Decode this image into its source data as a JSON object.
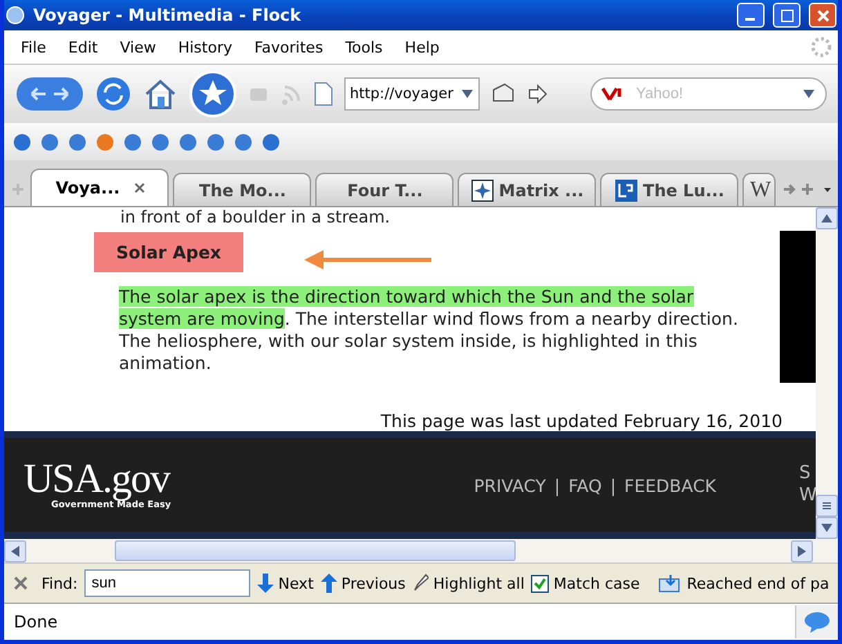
{
  "window": {
    "title": "Voyager - Multimedia - Flock"
  },
  "menu": [
    "File",
    "Edit",
    "View",
    "History",
    "Favorites",
    "Tools",
    "Help"
  ],
  "address": {
    "value": "http://voyager"
  },
  "search": {
    "placeholder": "Yahoo!"
  },
  "tabs": [
    {
      "label": "Voya...",
      "selected": true,
      "kind": "plain"
    },
    {
      "label": "The Mo...",
      "selected": false,
      "kind": "plain"
    },
    {
      "label": "Four T...",
      "selected": false,
      "kind": "plain"
    },
    {
      "label": "Matrix ...",
      "selected": false,
      "kind": "compass"
    },
    {
      "label": "The Lu...",
      "selected": false,
      "kind": "logo"
    },
    {
      "label": "W",
      "selected": false,
      "kind": "serif"
    }
  ],
  "page": {
    "cut_line": "in front of a boulder in a stream.",
    "heading": "Solar Apex",
    "highlighted": "The solar apex is the direction toward which the Sun and the solar system are moving",
    "rest": ". The interstellar wind flows from a nearby direction. The heliosphere, with our solar system inside, is highlighted in this animation.",
    "updated": "This page was last updated February 16, 2010"
  },
  "footer": {
    "logo": "USA.gov",
    "logo_tagline": "Government Made Easy",
    "links": [
      "PRIVACY",
      "FAQ",
      "FEEDBACK"
    ],
    "separator": "|",
    "cut_text": [
      "S",
      "W"
    ]
  },
  "find_bar": {
    "label": "Find:",
    "value": "sun",
    "next": "Next",
    "previous": "Previous",
    "highlight_all": "Highlight all",
    "match_case": {
      "label": "Match case",
      "checked": true
    },
    "message": "Reached end of pa"
  },
  "status_bar": {
    "text": "Done"
  }
}
